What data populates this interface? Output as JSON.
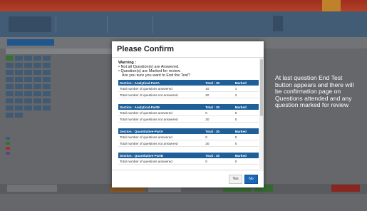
{
  "background": {
    "title_color": "#1e66b0",
    "header_color": "#4d6e8f",
    "top_strip_color": "#d63a22"
  },
  "modal": {
    "title": "Please Confirm",
    "warning": {
      "title": "Warning :",
      "lines": [
        "• Not all Question(s) are Answered.",
        "• Question(s) are Marked for review.",
        "  Are you sure you want to End the Test?"
      ]
    },
    "sections": [
      {
        "name": "Section : Analytical-PartA",
        "total_label": "Total : 30",
        "marked_label": "Marked",
        "rows": [
          {
            "label": "Total number of questions answered",
            "total": "10",
            "marked": "1"
          },
          {
            "label": "Total number of questions not answered",
            "total": "20",
            "marked": "2"
          }
        ]
      },
      {
        "name": "Section : Analytical-PartB",
        "total_label": "Total : 30",
        "marked_label": "Marked",
        "rows": [
          {
            "label": "Total number of questions answered",
            "total": "0",
            "marked": "0"
          },
          {
            "label": "Total number of questions not answered",
            "total": "30",
            "marked": "0"
          }
        ]
      },
      {
        "name": "Section : Quantitative-PartA",
        "total_label": "Total : 30",
        "marked_label": "Marked",
        "rows": [
          {
            "label": "Total number of questions answered",
            "total": "0",
            "marked": "0"
          },
          {
            "label": "Total number of questions not answered",
            "total": "30",
            "marked": "0"
          }
        ]
      },
      {
        "name": "Section : Quantitative-PartB",
        "total_label": "Total : 30",
        "marked_label": "Marked",
        "rows": [
          {
            "label": "Total number of questions answered",
            "total": "0",
            "marked": "0"
          }
        ]
      }
    ],
    "yes_label": "Yes",
    "no_label": "No"
  },
  "annotation": {
    "text": "At last question End Test button appears and there will be confirmation page on Questions attended and any question marked  for review"
  }
}
